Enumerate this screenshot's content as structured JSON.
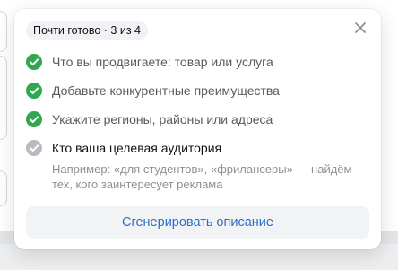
{
  "popup": {
    "progress_label": "Почти готово · 3 из 4",
    "steps": [
      {
        "label": "Что вы продвигаете: товар или услуга",
        "done": true
      },
      {
        "label": "Добавьте конкурентные преимущества",
        "done": true
      },
      {
        "label": "Укажите регионы, районы или адреса",
        "done": true
      },
      {
        "label": "Кто ваша целевая аудитория",
        "done": false,
        "hint": "Например: «для студентов», «фрилансеры» — найдём тех, кого заинтересует реклама"
      }
    ],
    "generate_button": "Сгенерировать описание"
  },
  "colors": {
    "done": "#2fa84f",
    "pending": "#b8bcc2",
    "accent": "#2a6fc9"
  },
  "icons": {
    "close": "close-icon",
    "done": "check-circle-icon",
    "pending": "check-circle-outline-icon"
  }
}
